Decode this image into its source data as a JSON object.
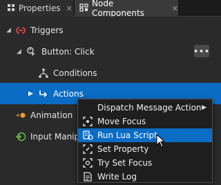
{
  "tabs": [
    {
      "label": "Properties",
      "icon": "properties-icon"
    },
    {
      "label": "Node Components",
      "icon": "node-components-icon",
      "active": true
    }
  ],
  "tree": {
    "triggers": {
      "label": "Triggers",
      "icon": "triggers-icon",
      "expanded": true
    },
    "button_click": {
      "label": "Button: Click",
      "icon": "button-click-icon",
      "expanded": true,
      "more_label": "•••"
    },
    "conditions": {
      "label": "Conditions",
      "icon": "conditions-icon"
    },
    "actions": {
      "label": "Actions",
      "icon": "actions-icon",
      "selected": true
    },
    "animation": {
      "label": "Animation",
      "icon": "animation-icon"
    },
    "input_manip": {
      "label": "Input Manipu",
      "icon": "input-manipulator-icon"
    }
  },
  "context_menu": {
    "items": [
      {
        "label": "Dispatch Message Action",
        "submenu": true
      },
      {
        "label": "Move Focus",
        "icon": "move-focus-icon"
      },
      {
        "label": "Run Lua Script",
        "icon": "lua-script-icon",
        "highlighted": true
      },
      {
        "label": "Set Property",
        "icon": "set-property-icon"
      },
      {
        "label": "Try Set Focus",
        "icon": "try-set-focus-icon"
      },
      {
        "label": "Write Log",
        "icon": "write-log-icon"
      }
    ]
  },
  "colors": {
    "selection": "#0b6cc4",
    "triggers_icon": "#e0474c",
    "animation_icon": "#f0a030",
    "input_icon": "#6cc04a"
  }
}
